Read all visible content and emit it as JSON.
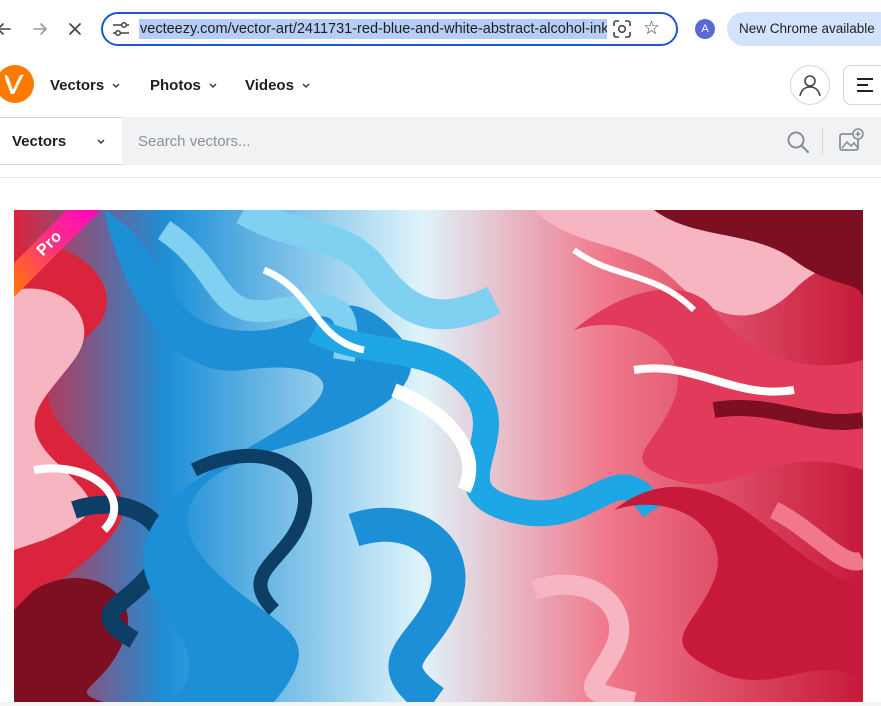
{
  "browser": {
    "back_icon": "arrow-left-icon",
    "forward_icon": "arrow-right-icon",
    "stop_icon": "close-icon",
    "url": "vecteezy.com/vector-art/2411731-red-blue-and-white-abstract-alcohol-ink",
    "profile_initial": "A",
    "update_label": "New Chrome available",
    "accent": "#1a56d6",
    "selection_color": "#b5cdf7",
    "chip_color": "#d3e3fd"
  },
  "site": {
    "brand_color": "#ff7a00",
    "nav": [
      {
        "label": "Vectors"
      },
      {
        "label": "Photos"
      },
      {
        "label": "Videos"
      }
    ]
  },
  "search": {
    "type_selected": "Vectors",
    "placeholder": "Search vectors..."
  },
  "preview": {
    "badge": "Pro",
    "palette": {
      "red": "#d9243c",
      "dark_red": "#7d0f22",
      "pink": "#f0788a",
      "blue": "#1d8fd6",
      "light_blue": "#7fd0f1",
      "navy": "#0d3e66",
      "white": "#ffffff"
    }
  }
}
